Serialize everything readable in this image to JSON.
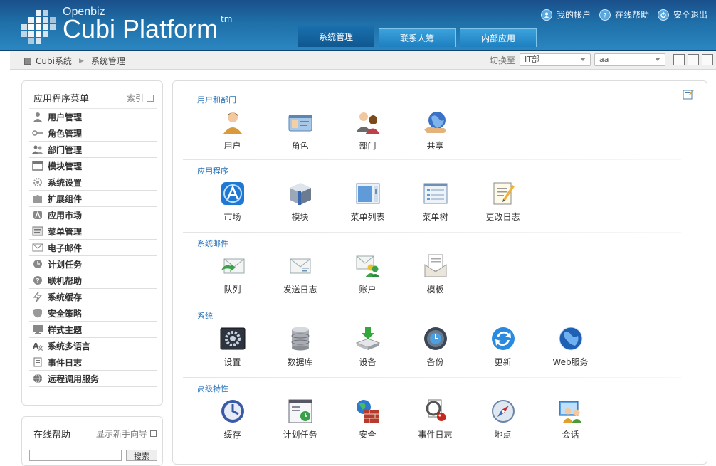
{
  "brand": {
    "small": "Openbiz",
    "big": "Cubi Platform",
    "tm": "tm"
  },
  "toplinks": [
    {
      "label": "我的帐户",
      "icon": "user-icon"
    },
    {
      "label": "在线帮助",
      "icon": "help-icon"
    },
    {
      "label": "安全退出",
      "icon": "logout-icon"
    }
  ],
  "navtabs": [
    {
      "label": "系统管理",
      "active": true
    },
    {
      "label": "联系人簿",
      "active": false
    },
    {
      "label": "内部应用",
      "active": false
    }
  ],
  "breadcrumb": {
    "root": "Cubi系统",
    "current": "系统管理"
  },
  "switch": {
    "label": "切换至",
    "dept": "IT部",
    "user": "aa"
  },
  "leftmenu": {
    "title": "应用程序菜单",
    "index_label": "索引",
    "items": [
      {
        "label": "用户管理",
        "icon": "user-icon"
      },
      {
        "label": "角色管理",
        "icon": "key-icon"
      },
      {
        "label": "部门管理",
        "icon": "group-icon"
      },
      {
        "label": "模块管理",
        "icon": "window-icon"
      },
      {
        "label": "系统设置",
        "icon": "gear-icon"
      },
      {
        "label": "扩展组件",
        "icon": "puzzle-icon"
      },
      {
        "label": "应用市场",
        "icon": "store-icon"
      },
      {
        "label": "菜单管理",
        "icon": "menu-icon"
      },
      {
        "label": "电子邮件",
        "icon": "mail-icon"
      },
      {
        "label": "计划任务",
        "icon": "clock-icon"
      },
      {
        "label": "联机帮助",
        "icon": "question-icon"
      },
      {
        "label": "系统缓存",
        "icon": "lightning-icon"
      },
      {
        "label": "安全策略",
        "icon": "shield-icon"
      },
      {
        "label": "样式主题",
        "icon": "monitor-icon"
      },
      {
        "label": "系统多语言",
        "icon": "language-icon"
      },
      {
        "label": "事件日志",
        "icon": "log-icon"
      },
      {
        "label": "远程调用服务",
        "icon": "globe-icon"
      }
    ]
  },
  "help": {
    "title": "在线帮助",
    "wizard": "显示新手向导",
    "search_btn": "搜索"
  },
  "sections": [
    {
      "title": "用户和部门",
      "apps": [
        {
          "label": "用户",
          "icon": "user-icon"
        },
        {
          "label": "角色",
          "icon": "role-card-icon"
        },
        {
          "label": "部门",
          "icon": "department-icon"
        },
        {
          "label": "共享",
          "icon": "share-globe-icon"
        }
      ]
    },
    {
      "title": "应用程序",
      "apps": [
        {
          "label": "市场",
          "icon": "appstore-icon"
        },
        {
          "label": "模块",
          "icon": "cube-icon"
        },
        {
          "label": "菜单列表",
          "icon": "window-list-icon"
        },
        {
          "label": "菜单树",
          "icon": "window-tree-icon"
        },
        {
          "label": "更改日志",
          "icon": "changelog-icon"
        }
      ]
    },
    {
      "title": "系统邮件",
      "apps": [
        {
          "label": "队列",
          "icon": "mail-queue-icon"
        },
        {
          "label": "发送日志",
          "icon": "mail-log-icon"
        },
        {
          "label": "账户",
          "icon": "mail-account-icon"
        },
        {
          "label": "模板",
          "icon": "mail-template-icon"
        }
      ]
    },
    {
      "title": "系统",
      "apps": [
        {
          "label": "设置",
          "icon": "settings-icon"
        },
        {
          "label": "数据库",
          "icon": "database-icon"
        },
        {
          "label": "设备",
          "icon": "device-icon"
        },
        {
          "label": "备份",
          "icon": "backup-icon"
        },
        {
          "label": "更新",
          "icon": "update-icon"
        },
        {
          "label": "Web服务",
          "icon": "webservice-icon"
        }
      ]
    },
    {
      "title": "高级特性",
      "apps": [
        {
          "label": "缓存",
          "icon": "cache-icon"
        },
        {
          "label": "计划任务",
          "icon": "cronjob-icon"
        },
        {
          "label": "安全",
          "icon": "security-icon"
        },
        {
          "label": "事件日志",
          "icon": "eventlog-icon"
        },
        {
          "label": "地点",
          "icon": "location-icon"
        },
        {
          "label": "会话",
          "icon": "session-icon"
        }
      ]
    }
  ]
}
